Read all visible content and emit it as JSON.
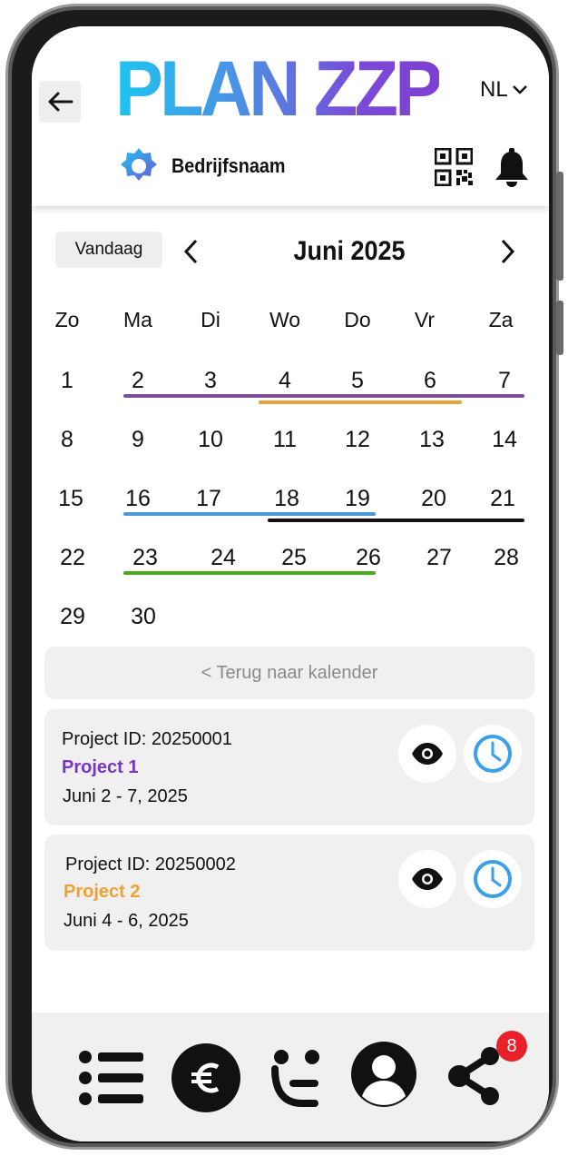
{
  "app": {
    "logo_text": "PLAN ZZP",
    "language": "NL"
  },
  "header": {
    "company_name": "Bedrijfsnaam",
    "notifications_icon": "bell-icon",
    "qr_icon": "qr-code-icon",
    "settings_icon": "gear-icon"
  },
  "calendar": {
    "today_label": "Vandaag",
    "month_label": "Juni 2025",
    "weekdays": [
      "Zo",
      "Ma",
      "Di",
      "Wo",
      "Do",
      "Vr",
      "Za"
    ],
    "weeks": [
      [
        "1",
        "2",
        "3",
        "4",
        "5",
        "6",
        "7"
      ],
      [
        "8",
        "9",
        "10",
        "11",
        "12",
        "13",
        "14"
      ],
      [
        "15",
        "16",
        "17",
        "18",
        "19",
        "20",
        "21"
      ],
      [
        "22",
        "23",
        "24",
        "25",
        "26",
        "27",
        "28"
      ],
      [
        "29",
        "30",
        "",
        "",
        "",
        "",
        ""
      ]
    ],
    "back_label": "< Terug naar kalender"
  },
  "projects": [
    {
      "id_label": "Project ID: 20250001",
      "name": "Project 1",
      "dates": "Juni 2 - 7, 2025",
      "color": "#7b35c4"
    },
    {
      "id_label": "Project ID: 20250002",
      "name": "Project 2",
      "dates": "Juni 4 - 6, 2025",
      "color": "#f0a030"
    }
  ],
  "range_colors": {
    "purple": "#7a4f9a",
    "orange": "#e8a23a",
    "blue": "#4a9ad8",
    "black": "#111111",
    "green": "#4aaa1a"
  },
  "bottom_nav": {
    "items": [
      "list-icon",
      "euro-icon",
      "smile-icon",
      "user-icon",
      "share-icon"
    ],
    "share_badge": "8"
  }
}
